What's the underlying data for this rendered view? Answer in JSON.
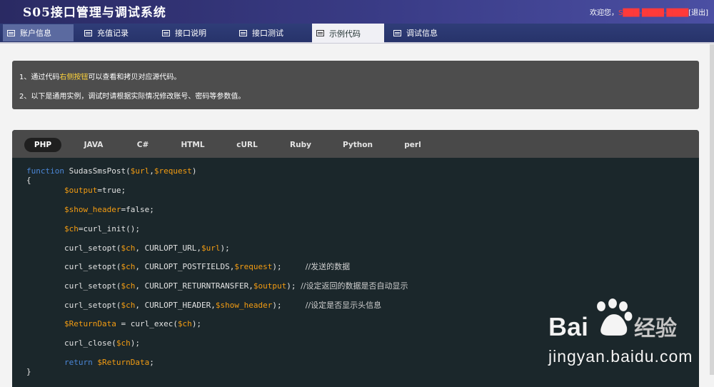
{
  "header": {
    "title": "S05接口管理与调试系统",
    "welcome": "欢迎您，",
    "username": "S███-████-████",
    "logout": "[退出]"
  },
  "nav": {
    "tabs": [
      {
        "label": "账户信息"
      },
      {
        "label": "充值记录"
      },
      {
        "label": "接口说明"
      },
      {
        "label": "接口测试"
      },
      {
        "label": "示例代码"
      },
      {
        "label": "调试信息"
      }
    ],
    "active_index": 4
  },
  "notice": {
    "line1_prefix": "1、通过代码",
    "line1_highlight": "右侧按钮",
    "line1_suffix": "可以查看和拷贝对应源代码。",
    "line2": "2、以下是通用实例，调试时请根据实际情况修改账号、密码等参数值。",
    "highlight_color": "#ffd43b"
  },
  "languages": [
    "PHP",
    "JAVA",
    "C#",
    "HTML",
    "cURL",
    "Ruby",
    "Python",
    "perl"
  ],
  "active_language": "PHP",
  "code": {
    "lines": [
      {
        "parts": [
          {
            "t": "function",
            "c": "kw"
          },
          {
            "t": " SudasSmsPost("
          },
          {
            "t": "$url",
            "c": "var"
          },
          {
            "t": ","
          },
          {
            "t": "$request",
            "c": "var"
          },
          {
            "t": ")"
          }
        ]
      },
      {
        "parts": [
          {
            "t": "{"
          }
        ]
      },
      {
        "parts": [
          {
            "t": "        "
          },
          {
            "t": "$output",
            "c": "var"
          },
          {
            "t": "=true;"
          }
        ]
      },
      {
        "parts": [
          {
            "t": "        "
          },
          {
            "t": "$show_header",
            "c": "var"
          },
          {
            "t": "=false;"
          }
        ]
      },
      {
        "parts": [
          {
            "t": "        "
          },
          {
            "t": "$ch",
            "c": "var"
          },
          {
            "t": "=curl_init();"
          }
        ]
      },
      {
        "parts": [
          {
            "t": "        curl_setopt("
          },
          {
            "t": "$ch",
            "c": "var"
          },
          {
            "t": ", CURLOPT_URL,"
          },
          {
            "t": "$url",
            "c": "var"
          },
          {
            "t": ");"
          }
        ]
      },
      {
        "parts": [
          {
            "t": "        curl_setopt("
          },
          {
            "t": "$ch",
            "c": "var"
          },
          {
            "t": ", CURLOPT_POSTFIELDS,"
          },
          {
            "t": "$request",
            "c": "var"
          },
          {
            "t": ");     "
          },
          {
            "t": "//发送的数据",
            "c": "cm"
          }
        ]
      },
      {
        "parts": [
          {
            "t": "        curl_setopt("
          },
          {
            "t": "$ch",
            "c": "var"
          },
          {
            "t": ", CURLOPT_RETURNTRANSFER,"
          },
          {
            "t": "$output",
            "c": "var"
          },
          {
            "t": "); "
          },
          {
            "t": "//设定返回的数据是否自动显示",
            "c": "cm"
          }
        ]
      },
      {
        "parts": [
          {
            "t": "        curl_setopt("
          },
          {
            "t": "$ch",
            "c": "var"
          },
          {
            "t": ", CURLOPT_HEADER,"
          },
          {
            "t": "$show_header",
            "c": "var"
          },
          {
            "t": ");     "
          },
          {
            "t": "//设定是否显示头信息",
            "c": "cm"
          }
        ]
      },
      {
        "parts": [
          {
            "t": "        "
          },
          {
            "t": "$ReturnData",
            "c": "var"
          },
          {
            "t": " = curl_exec("
          },
          {
            "t": "$ch",
            "c": "var"
          },
          {
            "t": ");"
          }
        ]
      },
      {
        "parts": [
          {
            "t": "        curl_close("
          },
          {
            "t": "$ch",
            "c": "var"
          },
          {
            "t": ");"
          }
        ]
      },
      {
        "parts": [
          {
            "t": "        "
          },
          {
            "t": "return",
            "c": "kw"
          },
          {
            "t": " "
          },
          {
            "t": "$ReturnData",
            "c": "var"
          },
          {
            "t": ";"
          }
        ]
      },
      {
        "parts": [
          {
            "t": "}"
          }
        ]
      }
    ]
  },
  "watermark": {
    "brand": "Bai",
    "brand2": "经验",
    "url": "jingyan.baidu.com"
  }
}
